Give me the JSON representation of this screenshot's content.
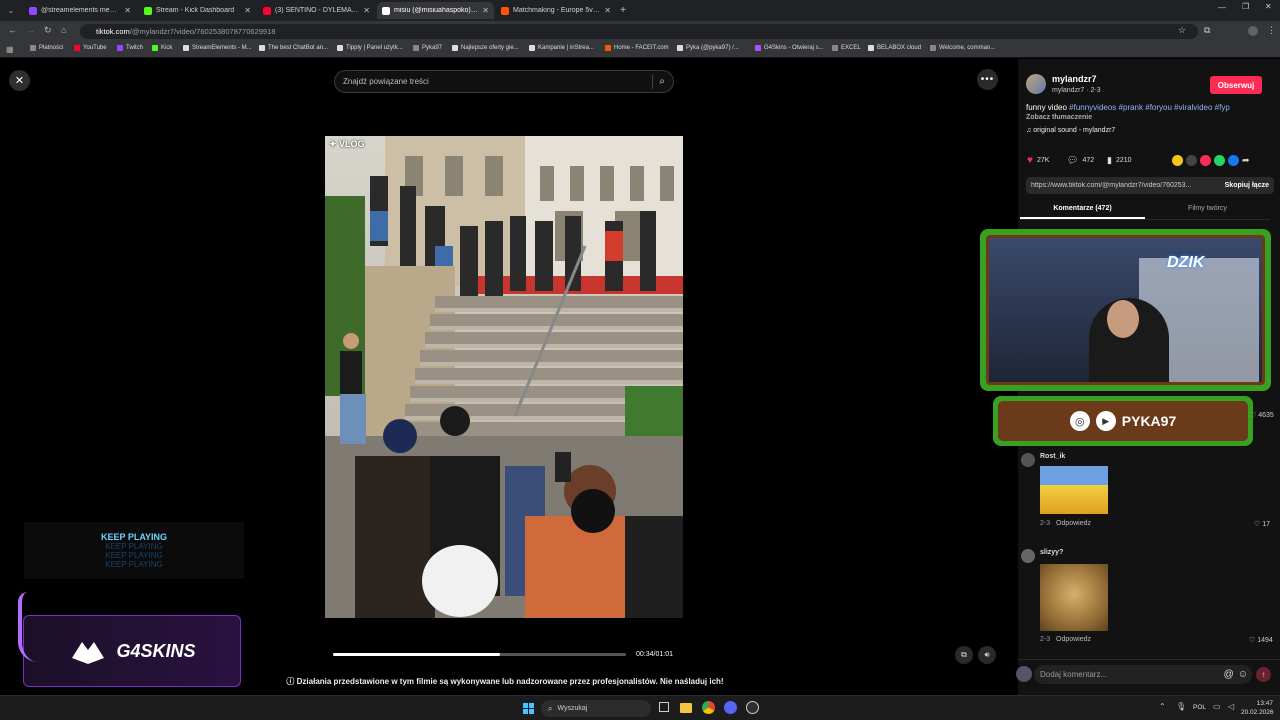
{
  "browser": {
    "tabs": [
      {
        "label": "@streamelements mention",
        "color": "#9146ff"
      },
      {
        "label": "Stream - Kick Dashboard",
        "color": "#53fc18"
      },
      {
        "label": "(3) SENTINO - DYLEMAT (prod",
        "color": "#ff0033"
      },
      {
        "label": "misiu (@misiuahaspoko) | Ti",
        "color": "#ffffff"
      },
      {
        "label": "Matchmaking - Europe 5v5 Qu",
        "color": "#ff5500"
      }
    ],
    "new_tab": "+",
    "url_domain": "tiktok.com",
    "url_path": "/@mylandzr7/video/7602538078770629918",
    "bookmarks": [
      {
        "label": "Płatności",
        "color": "#888"
      },
      {
        "label": "YouTube",
        "color": "#ff0033"
      },
      {
        "label": "Twitch",
        "color": "#9146ff"
      },
      {
        "label": "Kick",
        "color": "#53fc18"
      },
      {
        "label": "StreamElements - M...",
        "color": "#ddd"
      },
      {
        "label": "The best ChatBot an...",
        "color": "#ddd"
      },
      {
        "label": "Tipply | Panel użytk...",
        "color": "#ddd"
      },
      {
        "label": "Pyka97",
        "color": "#888"
      },
      {
        "label": "Najlepsze oferty gie...",
        "color": "#ddd"
      },
      {
        "label": "Kampanie | inStrea...",
        "color": "#ddd"
      },
      {
        "label": "Home - FACEIT.com",
        "color": "#ff5500"
      },
      {
        "label": "Pyka (@pyka97) /...",
        "color": "#ddd"
      },
      {
        "label": "G4Skins - Otwieraj s...",
        "color": "#a855f7"
      },
      {
        "label": "EXCEL",
        "color": "#888"
      },
      {
        "label": "BELABOX cloud",
        "color": "#ddd"
      },
      {
        "label": "Welcome, comman...",
        "color": "#888"
      }
    ]
  },
  "search": {
    "placeholder": "Znajdź powiązane treści"
  },
  "video": {
    "watermark": "VLOG",
    "time": "00:34/01:01",
    "progress": 0.57,
    "disclaimer": "Działania przedstawione w tym filmie są wykonywane lub nadzorowane przez profesjonalistów. Nie naśladuj ich!"
  },
  "author": {
    "name": "mylandzr7",
    "sub": "mylandzr7 · 2-3",
    "follow": "Obserwuj"
  },
  "description": {
    "text": "funny video",
    "tags": [
      "#funnyvideos",
      "#prank",
      "#foryou",
      "#viralvideo",
      "#fyp"
    ],
    "translate": "Zobacz tłumaczenie",
    "sound": "original sound - mylandzr7"
  },
  "stats": {
    "likes": "27K",
    "comments": "472",
    "saves": "2210"
  },
  "share": {
    "url": "https://www.tiktok.com/@mylandzr7/video/760253...",
    "copy": "Skopiuj łącze"
  },
  "panel_tabs": {
    "comments": "Komentarze (472)",
    "creator": "Filmy twórcy"
  },
  "comments": [
    {
      "user": "Rost_ik",
      "date": "2-3",
      "reply": "Odpowiedz",
      "likes": "17"
    },
    {
      "user": "slizyy?",
      "date": "2-3",
      "reply": "Odpowiedz",
      "likes": "1494"
    }
  ],
  "partial_like": "4635",
  "comment_input": {
    "placeholder": "Dodaj komentarz..."
  },
  "overlays": {
    "keep_playing": "KEEP PLAYING",
    "g4skins": "G4SKINS",
    "social": "PYKA97",
    "webcam_brand": "DZIK"
  },
  "taskbar": {
    "search": "Wyszukaj",
    "lang": "POL",
    "time": "13:47",
    "date": "20.02.2026"
  },
  "colors": {
    "follow": "#fe2c55",
    "tag": "#8ab4f8",
    "grass": "#3aa020",
    "wood": "#6b3a1a"
  }
}
